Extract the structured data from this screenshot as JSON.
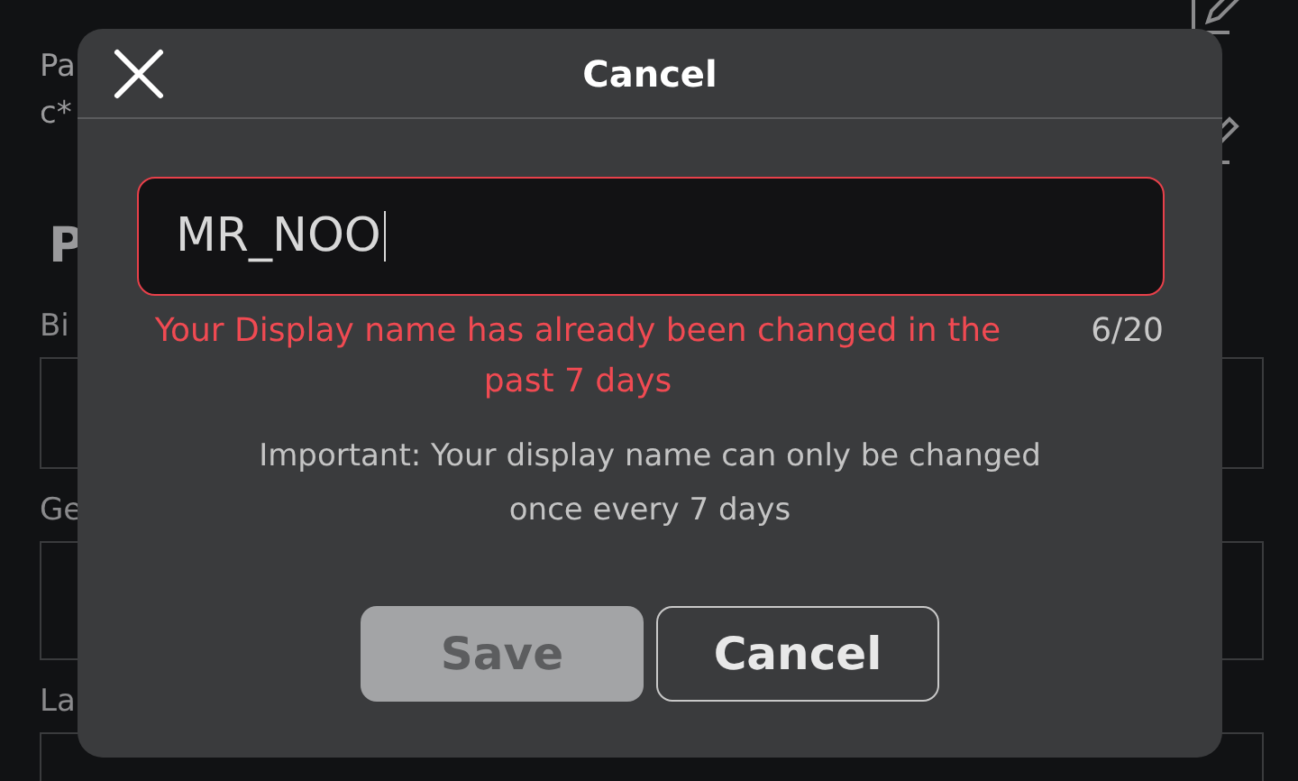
{
  "background": {
    "fields": [
      {
        "label": "Pa",
        "value": "c*"
      }
    ],
    "section_title": "P",
    "inputs": [
      {
        "label": "Bi"
      },
      {
        "label": "Ge"
      },
      {
        "label": "La"
      }
    ]
  },
  "dialog": {
    "title": "Cancel",
    "name_field": {
      "value": "MR_NOO",
      "error": true
    },
    "error_message": "Your Display name has already been changed in the past 7 days",
    "counter": "6/20",
    "note": "Important: Your display name can only be changed once every 7 days",
    "buttons": [
      {
        "label": "Save",
        "kind": "primary",
        "disabled": true
      },
      {
        "label": "Cancel",
        "kind": "secondary",
        "disabled": false
      }
    ]
  }
}
